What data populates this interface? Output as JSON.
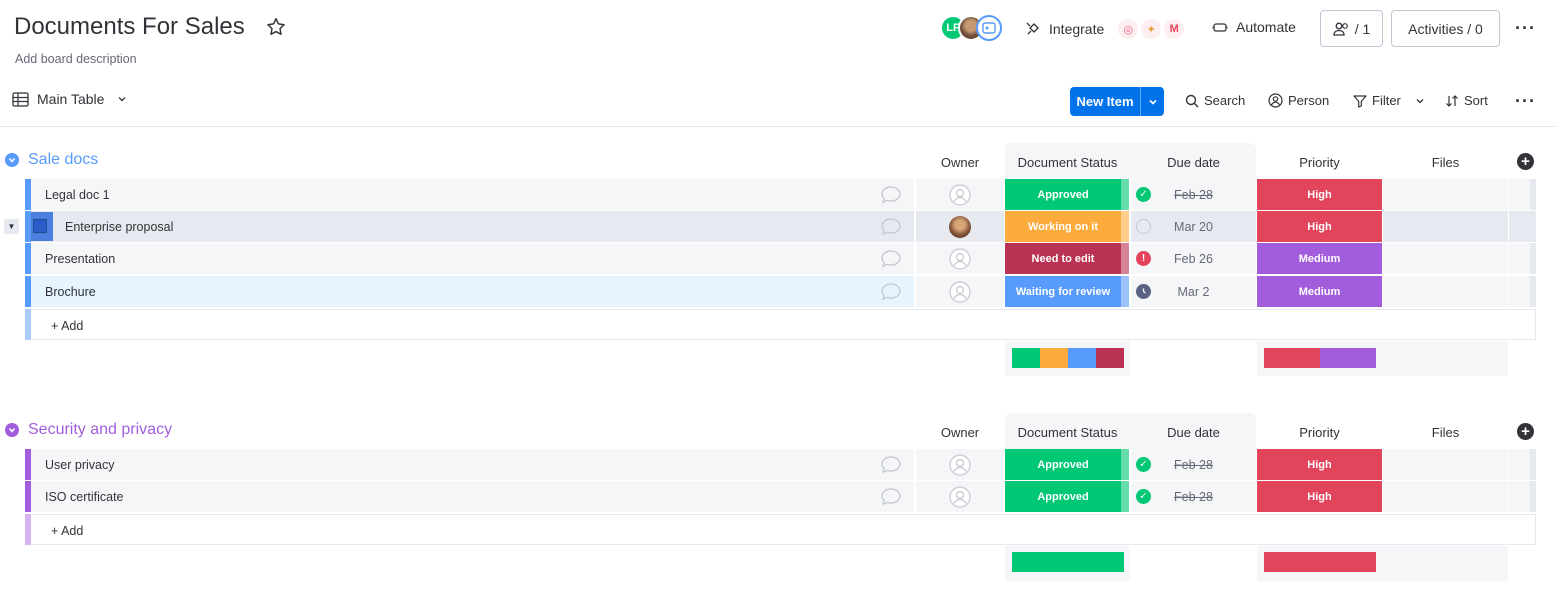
{
  "board": {
    "title": "Documents For Sales",
    "description": "Add board description"
  },
  "header": {
    "avatar_initials": "LF",
    "integrate_label": "Integrate",
    "automate_label": "Automate",
    "members_label": "/ 1",
    "activities_label": "Activities / 0"
  },
  "toolbar": {
    "view_label": "Main Table",
    "new_item_label": "New Item",
    "search_label": "Search",
    "person_label": "Person",
    "filter_label": "Filter",
    "sort_label": "Sort"
  },
  "columns": {
    "owner": "Owner",
    "status": "Document Status",
    "due": "Due date",
    "priority": "Priority",
    "files": "Files"
  },
  "colors": {
    "approved": "#00c875",
    "working": "#fdab3d",
    "need_edit": "#bb3354",
    "waiting": "#579bfc",
    "high": "#e2445c",
    "medium": "#a25ddc",
    "group1": "#579bfc",
    "group2": "#a25ddc"
  },
  "groups": [
    {
      "title": "Sale docs",
      "add_label": "+ Add",
      "rows": [
        {
          "name": "Legal doc 1",
          "status": "Approved",
          "due": "Feb 28",
          "priority": "High"
        },
        {
          "name": "Enterprise proposal",
          "status": "Working on it",
          "due": "Mar 20",
          "priority": "High"
        },
        {
          "name": "Presentation",
          "status": "Need to edit",
          "due": "Feb 26",
          "priority": "Medium"
        },
        {
          "name": "Brochure",
          "status": "Waiting for review",
          "due": "Mar 2",
          "priority": "Medium"
        }
      ]
    },
    {
      "title": "Security and privacy",
      "add_label": "+ Add",
      "rows": [
        {
          "name": "User privacy",
          "status": "Approved",
          "due": "Feb 28",
          "priority": "High"
        },
        {
          "name": "ISO certificate",
          "status": "Approved",
          "due": "Feb 28",
          "priority": "High"
        }
      ]
    }
  ]
}
